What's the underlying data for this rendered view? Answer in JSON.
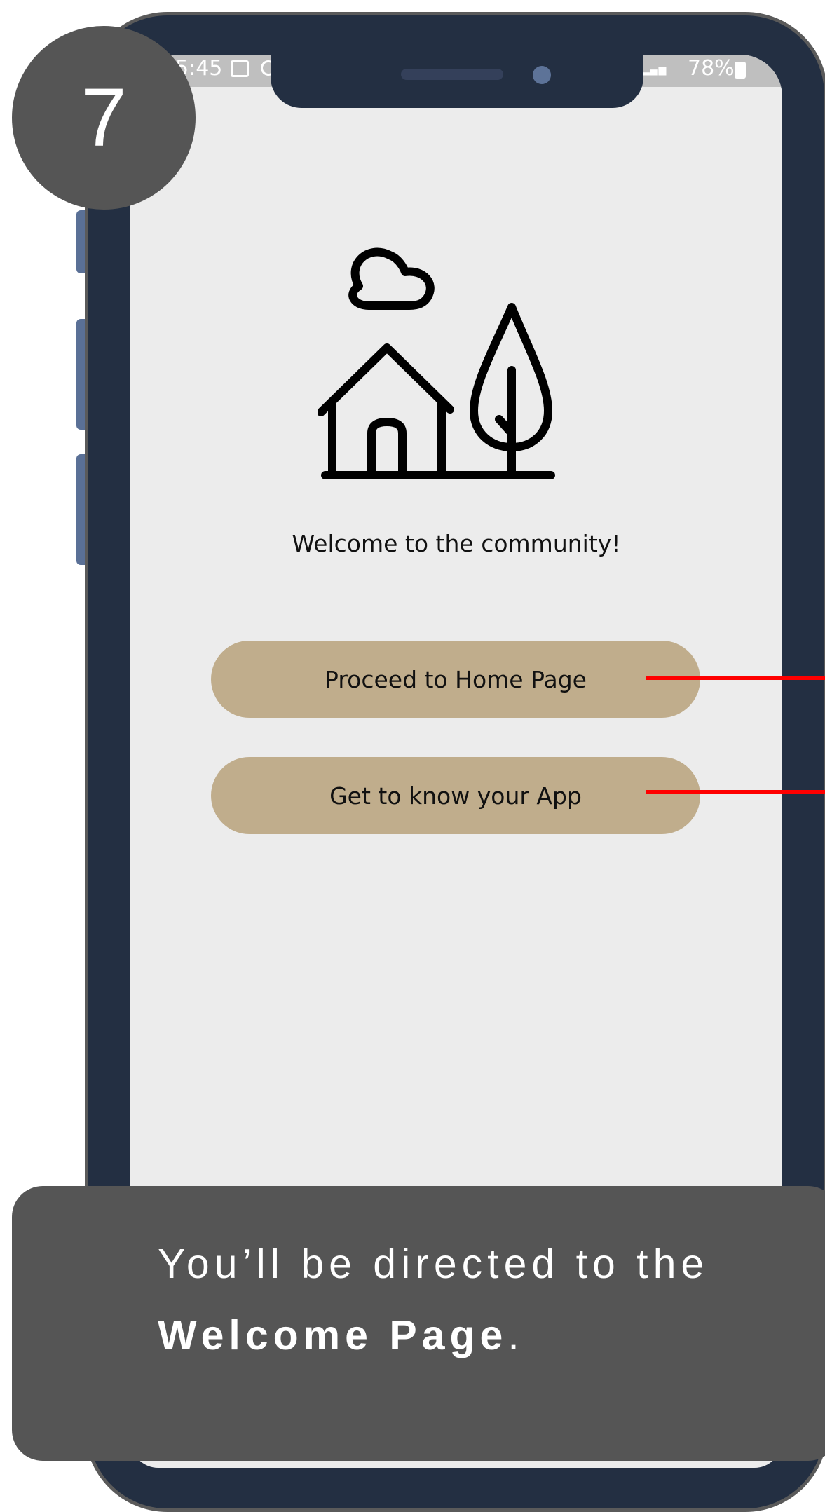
{
  "status_bar": {
    "time": "5:45",
    "battery": "78%",
    "icons": [
      "photo-icon",
      "sync-icon",
      "signal-icon",
      "battery-icon"
    ]
  },
  "step": {
    "number": "7"
  },
  "screen": {
    "illustration": "house-tree-cloud-icon",
    "welcome_text": "Welcome to the community!",
    "buttons": {
      "home_label": "Proceed to Home Page",
      "tour_label": "Get to know your App"
    }
  },
  "caption": {
    "text_before": "You’ll be directed to the ",
    "emphasis": "Welcome Page",
    "text_after": "."
  },
  "colors": {
    "frame": "#232f42",
    "button": "#c0ad8c",
    "badge": "#555555",
    "pointer": "#ff0000",
    "screen_bg": "#ececec"
  }
}
